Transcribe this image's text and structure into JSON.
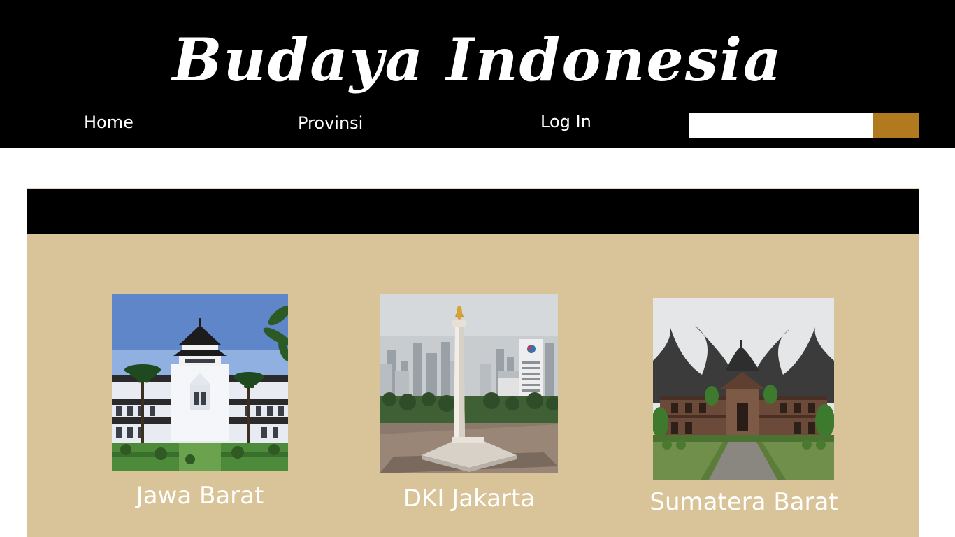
{
  "header": {
    "title": "Budaya Indonesia",
    "nav": {
      "home": "Home",
      "provinsi": "Provinsi",
      "login": "Log In"
    },
    "search": {
      "value": "",
      "placeholder": "",
      "button_color": "#b27a1f"
    }
  },
  "colors": {
    "header_bg": "#000000",
    "panel_bg": "#d9c499",
    "accent": "#b27a1f"
  },
  "provinces": [
    {
      "name": "Jawa Barat",
      "image": "gedung-sate-photo"
    },
    {
      "name": "DKI Jakarta",
      "image": "monas-photo"
    },
    {
      "name": "Sumatera Barat",
      "image": "rumah-gadang-photo"
    }
  ]
}
